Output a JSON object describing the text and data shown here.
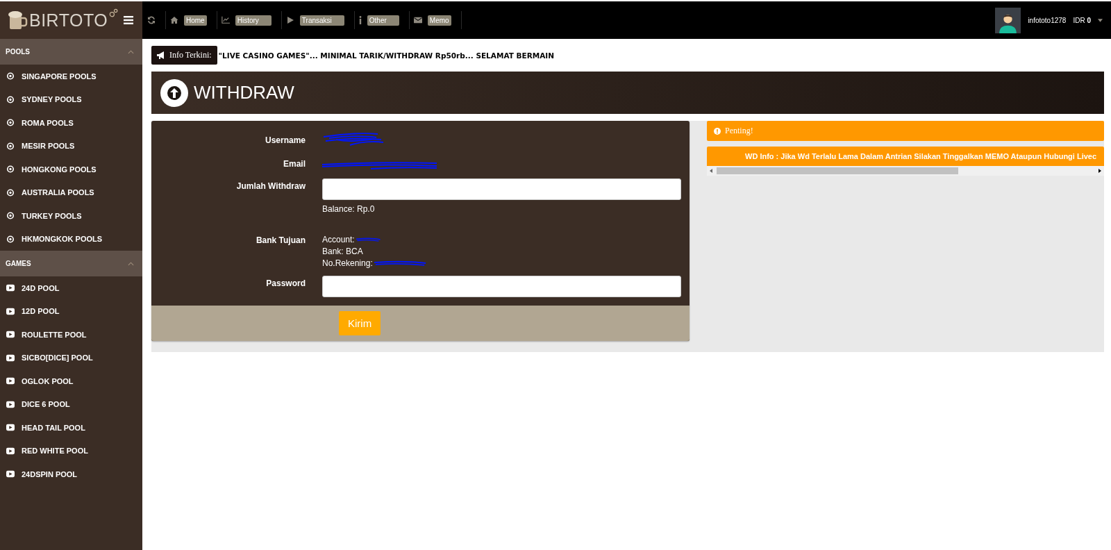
{
  "logo": {
    "text": "BIRTOTO"
  },
  "nav": [
    {
      "kind": "refresh"
    },
    {
      "kind": "home",
      "label": "Home"
    },
    {
      "kind": "chart",
      "label": "History"
    },
    {
      "kind": "play",
      "label": "Transaksi"
    },
    {
      "kind": "info",
      "label": "Other"
    },
    {
      "kind": "mail",
      "label": "Memo"
    }
  ],
  "user": {
    "name": "infototo1278",
    "currency": "IDR",
    "balance": "0"
  },
  "sidebar": [
    {
      "title": "POOLS",
      "expanded": true,
      "kind": "pool",
      "items": [
        "SINGAPORE POOLS",
        "SYDNEY POOLS",
        "ROMA POOLS",
        "MESIR POOLS",
        "HONGKONG POOLS",
        "AUSTRALIA POOLS",
        "TURKEY POOLS",
        "HKMONGKOK POOLS"
      ]
    },
    {
      "title": "GAMES",
      "expanded": true,
      "kind": "game",
      "items": [
        "24D POOL",
        "12D POOL",
        "ROULETTE POOL",
        "SICBO[DICE] POOL",
        "OGLOK POOL",
        "DICE 6 POOL",
        "HEAD TAIL POOL",
        "RED WHITE POOL",
        "24DSPIN POOL"
      ]
    }
  ],
  "ticker": {
    "label": "Info Terkini:",
    "text": "\"LIVE CASINO GAMES\"... MINIMAL TARIK/WITHDRAW Rp50rb... SELAMAT BERMAIN"
  },
  "page_title": "WITHDRAW",
  "form": {
    "username_label": "Username",
    "email_label": "Email",
    "amount_label": "Jumlah Withdraw",
    "balance": "Balance: Rp.0",
    "bank_label": "Bank Tujuan",
    "account": "Account:",
    "bank": "Bank: BCA",
    "rekening": "No.Rekening:",
    "password_label": "Password",
    "submit": "Kirim"
  },
  "notice": {
    "title": "Penting!",
    "text": "WD Info : Jika Wd Terlalu Lama Dalam Antrian Silakan Tinggalkan MEMO Ataupun Hubungi Livec"
  }
}
